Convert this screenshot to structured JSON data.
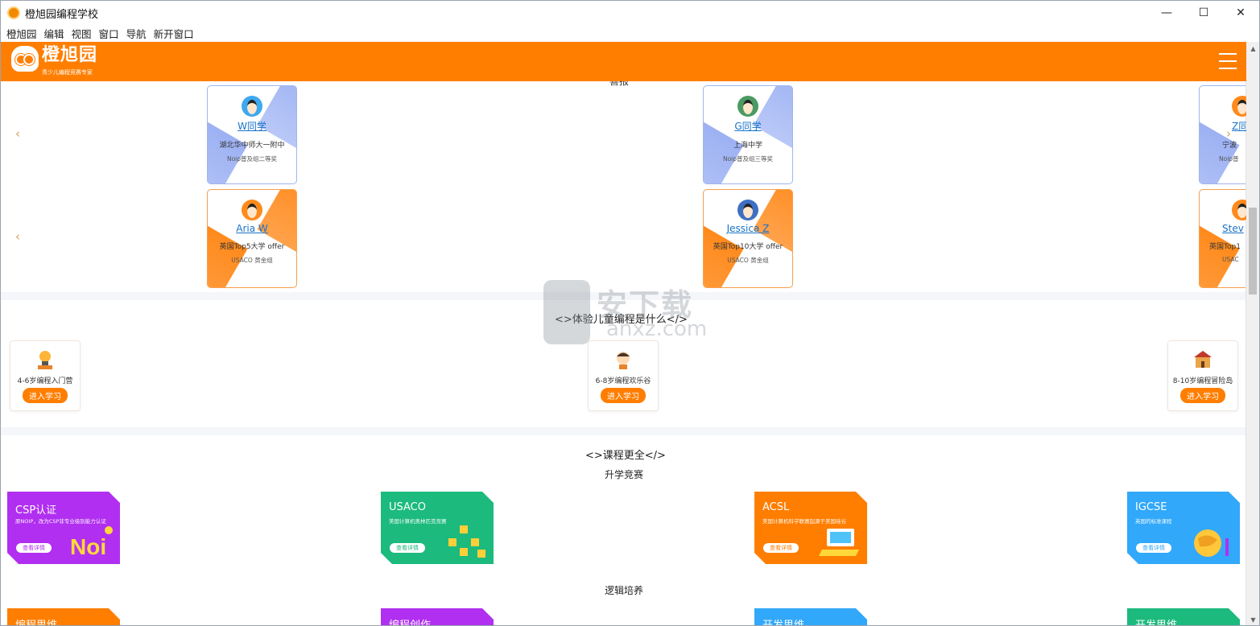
{
  "window": {
    "title": "橙旭园编程学校",
    "controls": {
      "minimize": "—",
      "maximize": "☐",
      "close": "✕"
    }
  },
  "menubar": [
    "橙旭园",
    "编辑",
    "视图",
    "窗口",
    "导航",
    "新开窗口"
  ],
  "header": {
    "logo_text": "橙旭园",
    "logo_subtitle": "青少儿编程竞赛专家"
  },
  "partial_section_title": "喜报",
  "students_row1": [
    {
      "name": "W同学",
      "school": "湖北华中师大一附中",
      "award": "Noip普及组二等奖"
    },
    {
      "name": "G同学",
      "school": "上海中学",
      "award": "Noip普及组三等奖"
    },
    {
      "name": "Z同",
      "school": "宁波",
      "award": "Noip普"
    }
  ],
  "students_row2": [
    {
      "name": "Aria W",
      "school": "英国Top5大学 offer",
      "award": "USACO 黄金组"
    },
    {
      "name": "Jessica Z",
      "school": "英国Top10大学 offer",
      "award": "USACO 黄金组"
    },
    {
      "name": "Stev",
      "school": "英国Top1",
      "award": "USAC"
    }
  ],
  "nav": {
    "prev": "‹",
    "next": "›"
  },
  "experience": {
    "title": "<>体验儿童编程是什么</>",
    "cards": [
      {
        "label": "4-6岁编程入门营",
        "button": "进入学习"
      },
      {
        "label": "6-8岁编程欢乐谷",
        "button": "进入学习"
      },
      {
        "label": "8-10岁编程冒险岛",
        "button": "进入学习"
      }
    ]
  },
  "courses": {
    "title": "<>课程更全</>",
    "group1_title": "升学竞赛",
    "group1": [
      {
        "name": "CSP认证",
        "desc": "原NOIP，改为CSP非专业级别能力认证",
        "button": "查看详情"
      },
      {
        "name": "USACO",
        "desc": "美国计算机奥林匹克竞赛",
        "button": "查看详情"
      },
      {
        "name": "ACSL",
        "desc": "美国计算机科学联赛起源于美国硅谷",
        "button": "查看详情"
      },
      {
        "name": "IGCSE",
        "desc": "英国的标准课程",
        "button": "查看详情"
      }
    ],
    "group2_title": "逻辑培养",
    "group2": [
      {
        "name": "编程思维"
      },
      {
        "name": "编程创作"
      },
      {
        "name": "开发思维"
      },
      {
        "name": "开发思维"
      }
    ]
  },
  "watermark": {
    "big": "安下载",
    "small": "anxz.com"
  },
  "colors": {
    "brand": "#ff7e00",
    "purple": "#b12ff0",
    "green": "#1cba7d",
    "blue": "#31a8fa",
    "link": "#1a73c8"
  }
}
